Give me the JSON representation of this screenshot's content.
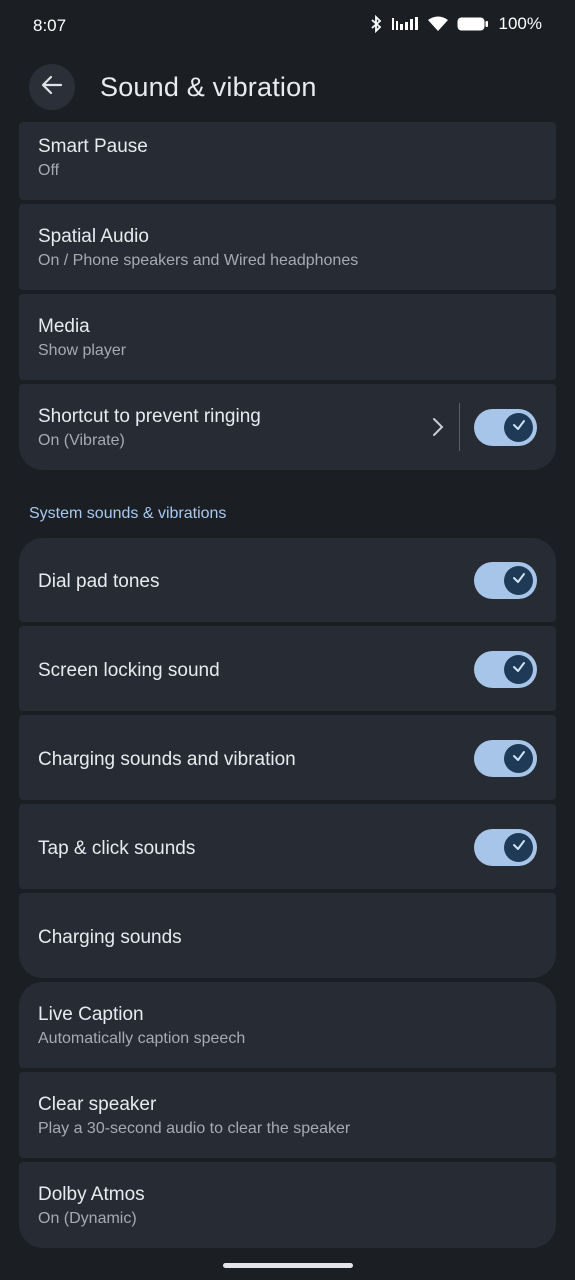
{
  "status_bar": {
    "time": "8:07",
    "battery": "100%",
    "icons": [
      "bluetooth-icon",
      "signal-icon",
      "wifi-icon",
      "battery-icon"
    ]
  },
  "header": {
    "title": "Sound & vibration",
    "back_icon": "arrow-back-icon"
  },
  "settings_top": [
    {
      "title": "Smart Pause",
      "subtitle": "Off"
    },
    {
      "title": "Spatial Audio",
      "subtitle": "On / Phone speakers and Wired headphones"
    },
    {
      "title": "Media",
      "subtitle": "Show player"
    },
    {
      "title": "Shortcut to prevent ringing",
      "subtitle": "On (Vibrate)",
      "toggle": true
    }
  ],
  "system_section": {
    "header": "System sounds & vibrations",
    "items": [
      {
        "title": "Dial pad tones",
        "toggle": true
      },
      {
        "title": "Screen locking sound",
        "toggle": true
      },
      {
        "title": "Charging sounds and vibration",
        "toggle": true
      },
      {
        "title": "Tap & click sounds",
        "toggle": true
      },
      {
        "title": "Charging sounds"
      }
    ]
  },
  "settings_bottom": [
    {
      "title": "Live Caption",
      "subtitle": "Automatically caption speech"
    },
    {
      "title": "Clear speaker",
      "subtitle": "Play a 30-second audio to clear the speaker"
    },
    {
      "title": "Dolby Atmos",
      "subtitle": "On (Dynamic)"
    }
  ],
  "colors": {
    "background": "#1b1f24",
    "card": "#272c34",
    "accent": "#a8c8f0",
    "toggle_track": "#a7c5e8",
    "toggle_knob": "#1f3a56"
  }
}
